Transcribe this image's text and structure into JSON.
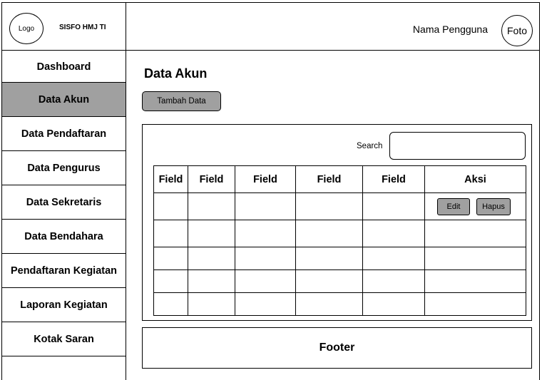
{
  "header": {
    "logo_text": "Logo",
    "app_name": "SISFO HMJ TI",
    "user_name": "Nama Pengguna",
    "user_photo": "Foto"
  },
  "sidebar": {
    "items": [
      {
        "label": "Dashboard",
        "active": false
      },
      {
        "label": "Data Akun",
        "active": true
      },
      {
        "label": "Data Pendaftaran",
        "active": false
      },
      {
        "label": "Data Pengurus",
        "active": false
      },
      {
        "label": "Data Sekretaris",
        "active": false
      },
      {
        "label": "Data Bendahara",
        "active": false
      },
      {
        "label": "Pendaftaran Kegiatan",
        "active": false
      },
      {
        "label": "Laporan Kegiatan",
        "active": false
      },
      {
        "label": "Kotak Saran",
        "active": false
      }
    ]
  },
  "main": {
    "title": "Data Akun",
    "add_button": "Tambah Data",
    "search_label": "Search",
    "search_value": "",
    "table": {
      "columns": [
        "Field",
        "Field",
        "Field",
        "Field",
        "Field",
        "Aksi"
      ],
      "row_count": 5,
      "row_actions": {
        "edit": "Edit",
        "delete": "Hapus"
      }
    }
  },
  "footer": {
    "label": "Footer"
  },
  "colors": {
    "button_fill": "#a0a0a0",
    "active_fill": "#a0a0a0",
    "border": "#000000"
  }
}
